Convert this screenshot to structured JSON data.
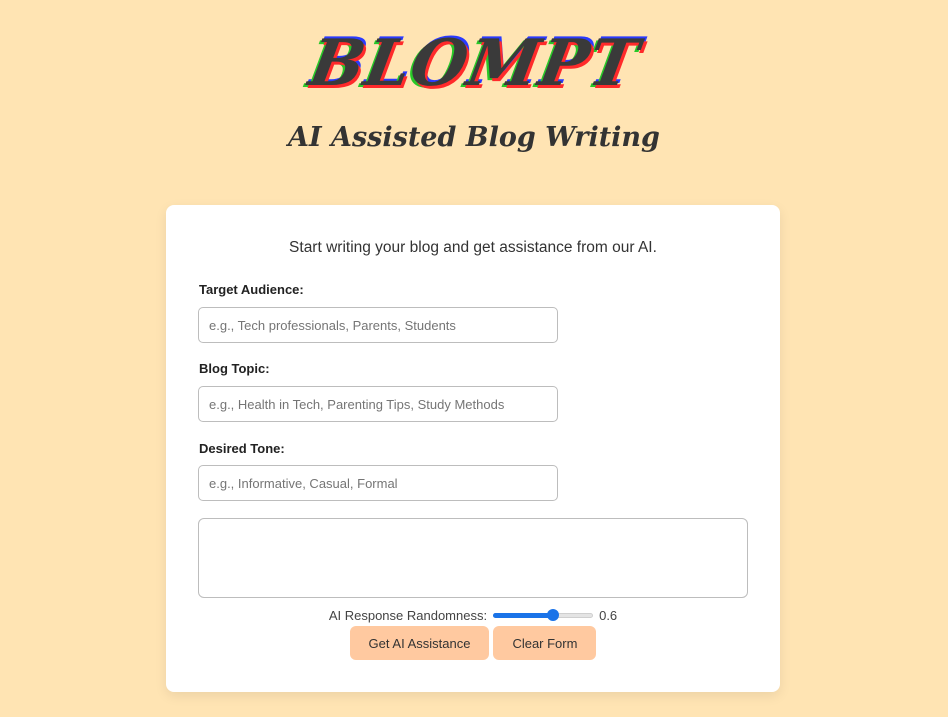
{
  "header": {
    "brand": "BLOMPT",
    "subtitle": "AI Assisted Blog Writing"
  },
  "form": {
    "intro": "Start writing your blog and get assistance from our AI.",
    "target_audience": {
      "label": "Target Audience:",
      "value": "",
      "placeholder": "e.g., Tech professionals, Parents, Students"
    },
    "blog_topic": {
      "label": "Blog Topic:",
      "value": "",
      "placeholder": "e.g., Health in Tech, Parenting Tips, Study Methods"
    },
    "desired_tone": {
      "label": "Desired Tone:",
      "value": "",
      "placeholder": "e.g., Informative, Casual, Formal"
    },
    "content": {
      "value": ""
    },
    "randomness": {
      "label": "AI Response Randomness:",
      "value": 0.6,
      "display": "0.6",
      "min": 0,
      "max": 1
    },
    "buttons": {
      "assist": "Get AI Assistance",
      "clear": "Clear Form"
    }
  },
  "colors": {
    "page_background": "#ffe4b3",
    "card_background": "#ffffff",
    "button_background": "#ffc9a0",
    "slider_accent": "#1a73e8"
  }
}
